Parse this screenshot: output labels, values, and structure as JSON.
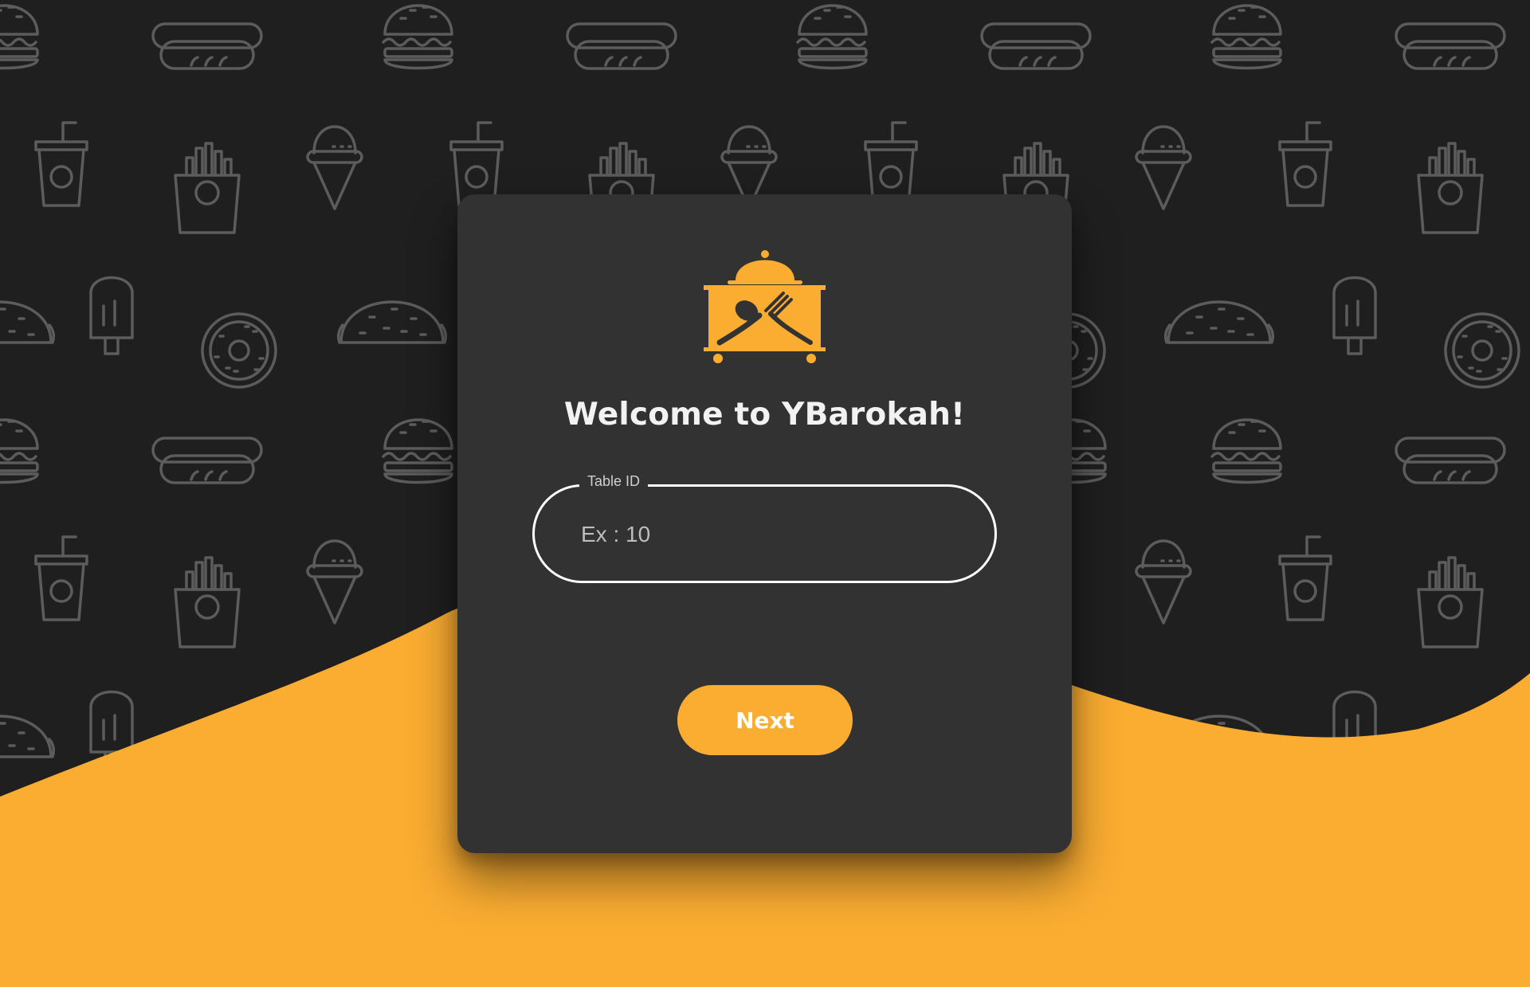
{
  "colors": {
    "background": "#1f1f1f",
    "pattern": "#5c5c5c",
    "accent": "#fbad31",
    "card": "#323232"
  },
  "background": {
    "pattern_icons": [
      "burger-icon",
      "hotdog-icon",
      "drink-icon",
      "ice-cream-icon",
      "fries-icon",
      "popsicle-icon",
      "donut-icon",
      "taco-icon"
    ]
  },
  "card": {
    "logo_icon": "food-cart-icon",
    "title": "Welcome to YBarokah!",
    "table_field": {
      "label": "Table ID",
      "placeholder": "Ex : 10",
      "value": ""
    },
    "next_label": "Next"
  }
}
